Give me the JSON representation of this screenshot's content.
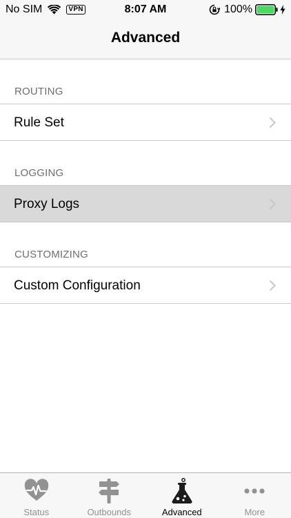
{
  "status_bar": {
    "carrier": "No SIM",
    "vpn": "VPN",
    "time": "8:07 AM",
    "battery": "100%"
  },
  "nav": {
    "title": "Advanced"
  },
  "sections": [
    {
      "header": "ROUTING",
      "items": [
        {
          "label": "Rule Set"
        }
      ]
    },
    {
      "header": "LOGGING",
      "items": [
        {
          "label": "Proxy Logs",
          "highlighted": true
        }
      ]
    },
    {
      "header": "CUSTOMIZING",
      "items": [
        {
          "label": "Custom Configuration"
        }
      ]
    }
  ],
  "tabs": [
    {
      "label": "Status",
      "icon": "heart-pulse-icon"
    },
    {
      "label": "Outbounds",
      "icon": "signpost-icon"
    },
    {
      "label": "Advanced",
      "icon": "flask-icon",
      "active": true
    },
    {
      "label": "More",
      "icon": "more-dots-icon"
    }
  ],
  "colors": {
    "bar_background": "#f7f7f7",
    "separator": "#c8c7cc",
    "section_header": "#6d6d72",
    "highlight": "#d9d9d9",
    "tab_inactive": "#929292",
    "tab_active": "#000000",
    "battery_green": "#4cd964"
  }
}
